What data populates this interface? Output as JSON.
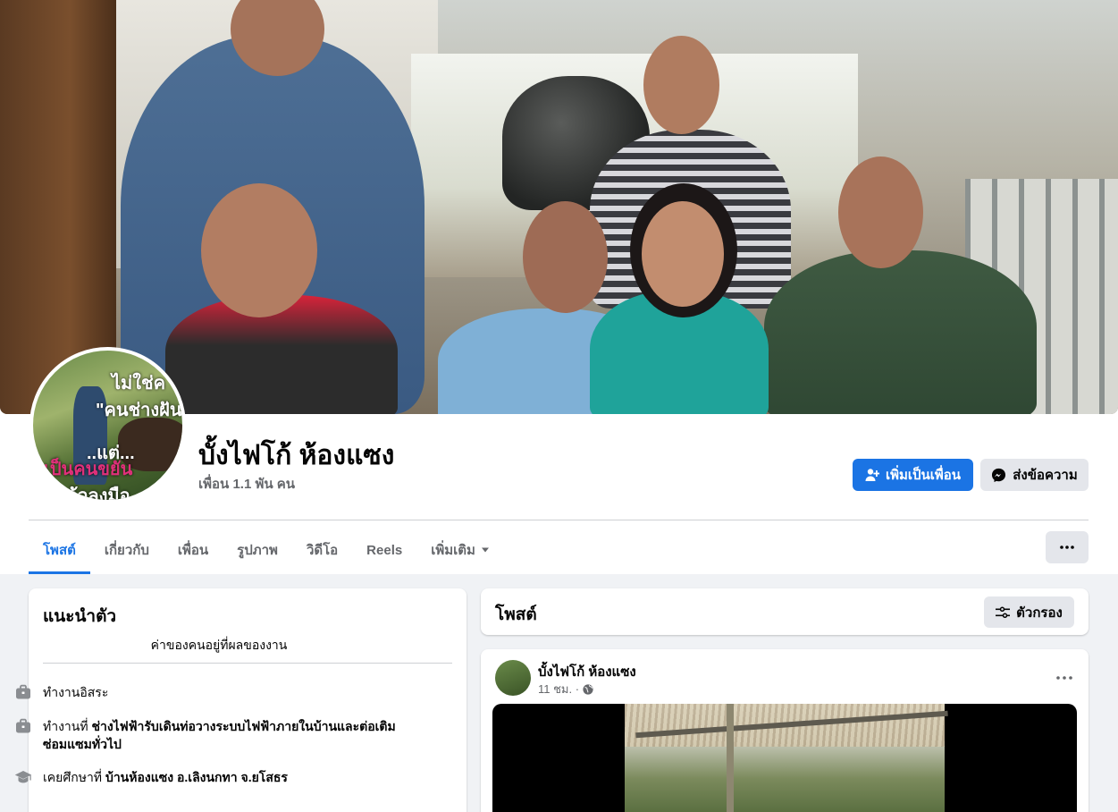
{
  "profile": {
    "name": "บั้งไฟโก้ ห้องแซง",
    "friends": "เพื่อน 1.1 พัน คน"
  },
  "avatar_text": [
    "ไม่ใช่ค",
    "\"คนช่างฝัน\"",
    "..แต่...",
    "เป็นคนขยัน",
    "แล้วลงมือ"
  ],
  "actions": {
    "add_friend": "เพิ่มเป็นเพื่อน",
    "message": "ส่งข้อความ"
  },
  "tabs": [
    {
      "label": "โพสต์"
    },
    {
      "label": "เกี่ยวกับ"
    },
    {
      "label": "เพื่อน"
    },
    {
      "label": "รูปภาพ"
    },
    {
      "label": "วิดีโอ"
    },
    {
      "label": "Reels"
    },
    {
      "label": "เพิ่มเติม"
    }
  ],
  "intro": {
    "title": "แนะนำตัว",
    "bio": "ค่าของคนอยู่ที่ผลของงาน",
    "items": [
      {
        "prefix": "ทำงานอิสระ",
        "bold": ""
      },
      {
        "prefix": "ทำงานที่ ",
        "bold": "ช่างไฟฟ้ารับเดินท่อวางระบบไฟฟ้าภายในบ้านและต่อเติมซ่อมแซมทั่วไป"
      },
      {
        "prefix": "เคยศึกษาที่ ",
        "bold": "บ้านห้องแซง อ.เลิงนกทา จ.ยโสธร"
      }
    ]
  },
  "posts": {
    "title": "โพสต์",
    "filter_label": "ตัวกรอง"
  },
  "post": {
    "author": "บั้งไฟโก้ ห้องแซง",
    "time": "11 ชม. ·"
  },
  "colors": {
    "accent": "#1b74e4",
    "secondary_button": "#e4e6eb",
    "page_bg": "#f0f2f5",
    "muted_text": "#65676b"
  }
}
